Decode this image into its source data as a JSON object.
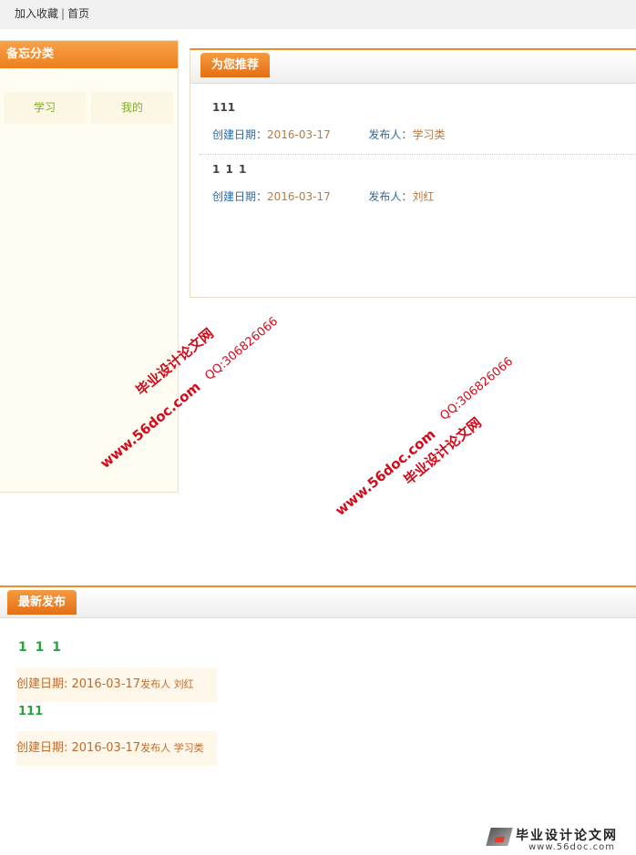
{
  "topbar": {
    "bookmark": "加入收藏",
    "separator": "|",
    "home": "首页"
  },
  "sidebar": {
    "title": "备忘分类",
    "categories": [
      {
        "label": "学习"
      },
      {
        "label": "我的"
      }
    ]
  },
  "recommend": {
    "title": "为您推荐",
    "created_label": "创建日期：",
    "publisher_label": "发布人：",
    "items": [
      {
        "title": "111",
        "date": "2016-03-17",
        "publisher": "学习类"
      },
      {
        "title": "1 1 1",
        "date": "2016-03-17",
        "publisher": "刘红"
      }
    ]
  },
  "watermarks": {
    "site_name": "毕业设计论文网",
    "qq": "QQ:306826066",
    "url": "www.56doc.com"
  },
  "latest": {
    "title": "最新发布",
    "created_label": "创建日期: ",
    "publisher_label": "发布人 ",
    "items": [
      {
        "title": "1 1 1",
        "date": "2016-03-17",
        "publisher": "刘红"
      },
      {
        "title": "111",
        "date": "2016-03-17",
        "publisher": "学习类"
      }
    ]
  },
  "brand": {
    "name": "毕业设计论文网",
    "url": "www.56doc.com"
  },
  "colors": {
    "accent": "#ee8a2b",
    "watermark": "#d2091a",
    "link_green": "#29a33d"
  }
}
